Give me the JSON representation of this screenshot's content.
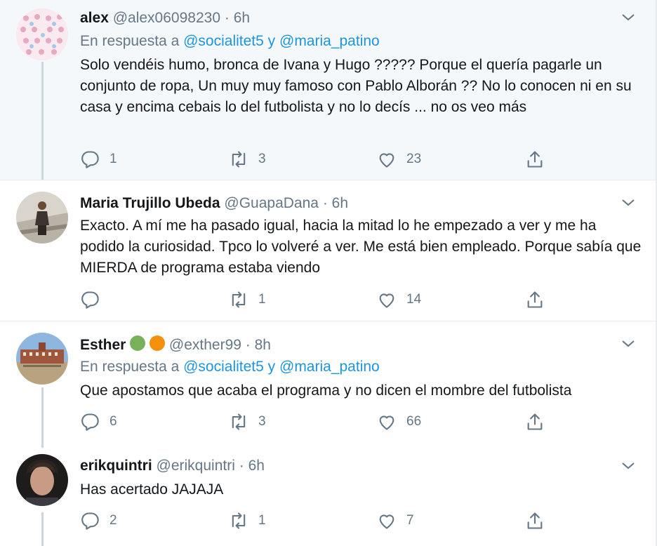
{
  "tweets": [
    {
      "name": "alex",
      "handle": "@alex06098230",
      "time": "6h",
      "replying_prefix": "En respuesta a",
      "mention1": "@socialitet5",
      "joiner": "y",
      "mention2": "@maria_patino",
      "text": "Solo vendéis humo, bronca de Ivana y Hugo ????? Porque el quería pagarle un conjunto de ropa, Un muy muy famoso con Pablo Alborán ?? No lo conocen ni en su casa y encima cebais lo del futbolista y no lo decís ... no os veo más",
      "replies": "1",
      "retweets": "3",
      "likes": "23"
    },
    {
      "name": "Maria Trujillo Ubeda",
      "handle": "@GuapaDana",
      "time": "6h",
      "text": "Exacto. A mí me ha pasado igual, hacia la mitad lo he empezado a ver y me ha podido la curiosidad. Tpco lo volveré a ver. Me está bien empleado. Porque sabía que MIERDA de programa estaba viendo",
      "replies": "",
      "retweets": "1",
      "likes": "14"
    },
    {
      "name": "Esther",
      "handle": "@exther99",
      "time": "8h",
      "replying_prefix": "En respuesta a",
      "mention1": "@socialitet5",
      "joiner": "y",
      "mention2": "@maria_patino",
      "text": "Que apostamos que acaba el programa y no dicen el mombre del futbolista",
      "replies": "6",
      "retweets": "3",
      "likes": "66"
    },
    {
      "name": "erikquintri",
      "handle": "@erikquintri",
      "time": "6h",
      "text": "Has acertado JAJAJA",
      "replies": "2",
      "retweets": "1",
      "likes": "7"
    }
  ],
  "separator": "·",
  "icons": [
    "reply-icon",
    "retweet-icon",
    "like-icon",
    "share-icon",
    "chevron-down-icon",
    "green-heart-emoji",
    "orange-heart-emoji"
  ],
  "colors": {
    "text": "#14171a",
    "muted": "#657786",
    "link": "#1b95e0",
    "highlight_bg": "#f5f8fa",
    "border": "#e6ecf0",
    "thread_line": "#ccd6dd"
  }
}
